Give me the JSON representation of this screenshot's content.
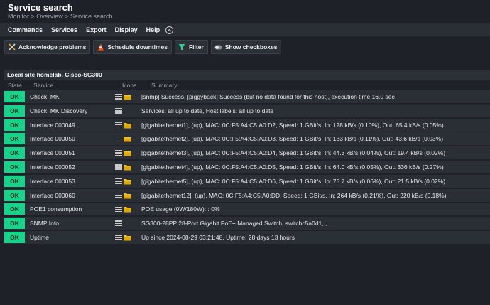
{
  "header": {
    "title": "Service search",
    "breadcrumb": "Monitor > Overview > Service search"
  },
  "menu": {
    "items": [
      "Commands",
      "Services",
      "Export",
      "Display",
      "Help"
    ]
  },
  "toolbar": {
    "acknowledge": "Acknowledge problems",
    "downtimes": "Schedule downtimes",
    "filter": "Filter",
    "checkboxes": "Show checkboxes"
  },
  "site": {
    "title": "Local site homelab, Cisco-SG300"
  },
  "columns": {
    "state": "State",
    "service": "Service",
    "icons": "Icons",
    "summary": "Summary"
  },
  "rows": [
    {
      "state": "OK",
      "service": "Check_MK",
      "summary": "[snmp] Success, [piggyback] Success (but no data found for this host), execution time 16.0 sec"
    },
    {
      "state": "OK",
      "service": "Check_MK Discovery",
      "summary": "Services: all up to date, Host labels: all up to date"
    },
    {
      "state": "OK",
      "service": "Interface 000049",
      "summary": "[gigabitethernet1], (up), MAC: 0C:F5:A4:C5:A0:D2, Speed: 1 GBit/s, In: 128 kB/s (0.10%), Out: 65.4 kB/s (0.05%)"
    },
    {
      "state": "OK",
      "service": "Interface 000050",
      "summary": "[gigabitethernet2], (up), MAC: 0C:F5:A4:C5:A0:D3, Speed: 1 GBit/s, In: 133 kB/s (0.11%), Out: 43.6 kB/s (0.03%)"
    },
    {
      "state": "OK",
      "service": "Interface 000051",
      "summary": "[gigabitethernet3], (up), MAC: 0C:F5:A4:C5:A0:D4, Speed: 1 GBit/s, In: 44.3 kB/s (0.04%), Out: 19.4 kB/s (0.02%)"
    },
    {
      "state": "OK",
      "service": "Interface 000052",
      "summary": "[gigabitethernet4], (up), MAC: 0C:F5:A4:C5:A0:D5, Speed: 1 GBit/s, In: 64.0 kB/s (0.05%), Out: 336 kB/s (0.27%)"
    },
    {
      "state": "OK",
      "service": "Interface 000053",
      "summary": "[gigabitethernet5], (up), MAC: 0C:F5:A4:C5:A0:D6, Speed: 1 GBit/s, In: 75.7 kB/s (0.06%), Out: 21.5 kB/s (0.02%)"
    },
    {
      "state": "OK",
      "service": "Interface 000060",
      "summary": "[gigabitethernet12], (up), MAC: 0C:F5:A4:C5:A0:DD, Speed: 1 GBit/s, In: 264 kB/s (0.21%), Out: 220 kB/s (0.18%)"
    },
    {
      "state": "OK",
      "service": "POE1 consumption",
      "summary": "POE usage (0W/180W): : 0%"
    },
    {
      "state": "OK",
      "service": "SNMP Info",
      "summary": "SG300-28PP 28-Port Gigabit PoE+ Managed Switch, switchc5a0d1, ,"
    },
    {
      "state": "OK",
      "service": "Uptime",
      "summary": "Up since 2024-08-29 03:21:48, Uptime: 28 days 13 hours"
    }
  ],
  "row_icons": [
    [
      "menu-icon",
      "folder-icon"
    ],
    [
      "menu-icon"
    ],
    [
      "menu-icon",
      "folder-icon"
    ],
    [
      "menu-icon",
      "folder-icon"
    ],
    [
      "menu-icon",
      "folder-icon"
    ],
    [
      "menu-icon",
      "folder-icon"
    ],
    [
      "menu-icon",
      "folder-icon"
    ],
    [
      "menu-icon",
      "folder-icon"
    ],
    [
      "menu-icon",
      "folder-icon"
    ],
    [
      "menu-icon"
    ],
    [
      "menu-icon",
      "folder-icon"
    ]
  ],
  "colors": {
    "ok": "#15d389",
    "background": "#1e2127",
    "row": "#2a2e35",
    "folder": "#f5c518"
  }
}
